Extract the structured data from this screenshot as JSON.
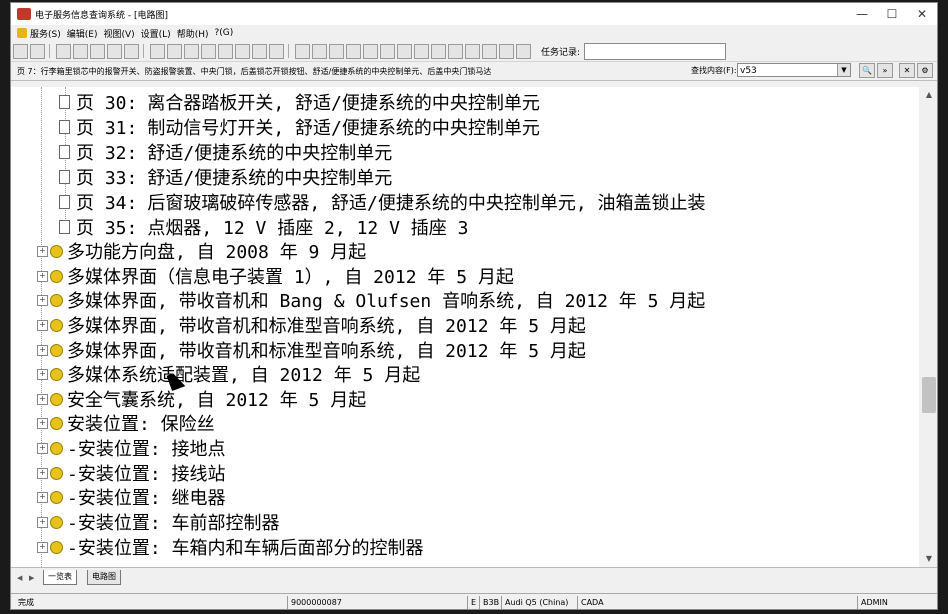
{
  "window": {
    "title": "电子服务信息查询系统 - [电路图]",
    "controls": [
      "—",
      "☐",
      "✕"
    ]
  },
  "menu": [
    {
      "label": "服务(S)"
    },
    {
      "label": "编辑(E)"
    },
    {
      "label": "视图(V)"
    },
    {
      "label": "设置(L)"
    },
    {
      "label": "帮助(H)"
    },
    {
      "label": "?(G)"
    }
  ],
  "toolbar": {
    "task_label": "任务记录:",
    "task_value": ""
  },
  "hintbar": {
    "hint": "页 7：行李箱里锁芯中的报警开关、防盗报警装置、中央门锁，后盖锁芯开锁按钮、舒适/便捷系统的中央控制单元、后盖中央门锁马达",
    "search_label": "查找内容(F):",
    "search_value": "v53"
  },
  "tree": {
    "pages": [
      {
        "num": "页  30:",
        "text": "离合器踏板开关, 舒适/便捷系统的中央控制单元"
      },
      {
        "num": "页  31:",
        "text": "制动信号灯开关, 舒适/便捷系统的中央控制单元"
      },
      {
        "num": "页  32:",
        "text": "舒适/便捷系统的中央控制单元"
      },
      {
        "num": "页  33:",
        "text": "舒适/便捷系统的中央控制单元"
      },
      {
        "num": "页  34:",
        "text": "后窗玻璃破碎传感器, 舒适/便捷系统的中央控制单元, 油箱盖锁止装"
      },
      {
        "num": "页  35:",
        "text": "点烟器, 12 V 插座 2, 12 V 插座 3"
      }
    ],
    "topics": [
      "多功能方向盘, 自 2008 年 9 月起",
      "多媒体界面（信息电子装置 1）, 自 2012 年 5 月起",
      "多媒体界面, 带收音机和 Bang & Olufsen 音响系统, 自 2012 年 5 月起",
      "多媒体界面, 带收音机和标准型音响系统, 自 2012 年 5 月起",
      "多媒体界面, 带收音机和标准型音响系统, 自 2012 年 5 月起",
      "多媒体系统适配装置, 自 2012 年 5 月起",
      "安全气囊系统, 自 2012 年 5 月起",
      "安装位置: 保险丝",
      "-安装位置: 接地点",
      "-安装位置: 接线站",
      "-安装位置: 继电器",
      "-安装位置: 车前部控制器",
      "-安装位置: 车箱内和车辆后面部分的控制器"
    ],
    "expander": "+"
  },
  "tabs": [
    {
      "label": "一览表"
    },
    {
      "label": "电路图"
    }
  ],
  "status": {
    "ready": "完成",
    "doc_id": "9000000087",
    "code1": "E",
    "code2": "B3B",
    "model": "Audi Q5 (China)",
    "lang": "CADA",
    "user": "ADMIN"
  }
}
